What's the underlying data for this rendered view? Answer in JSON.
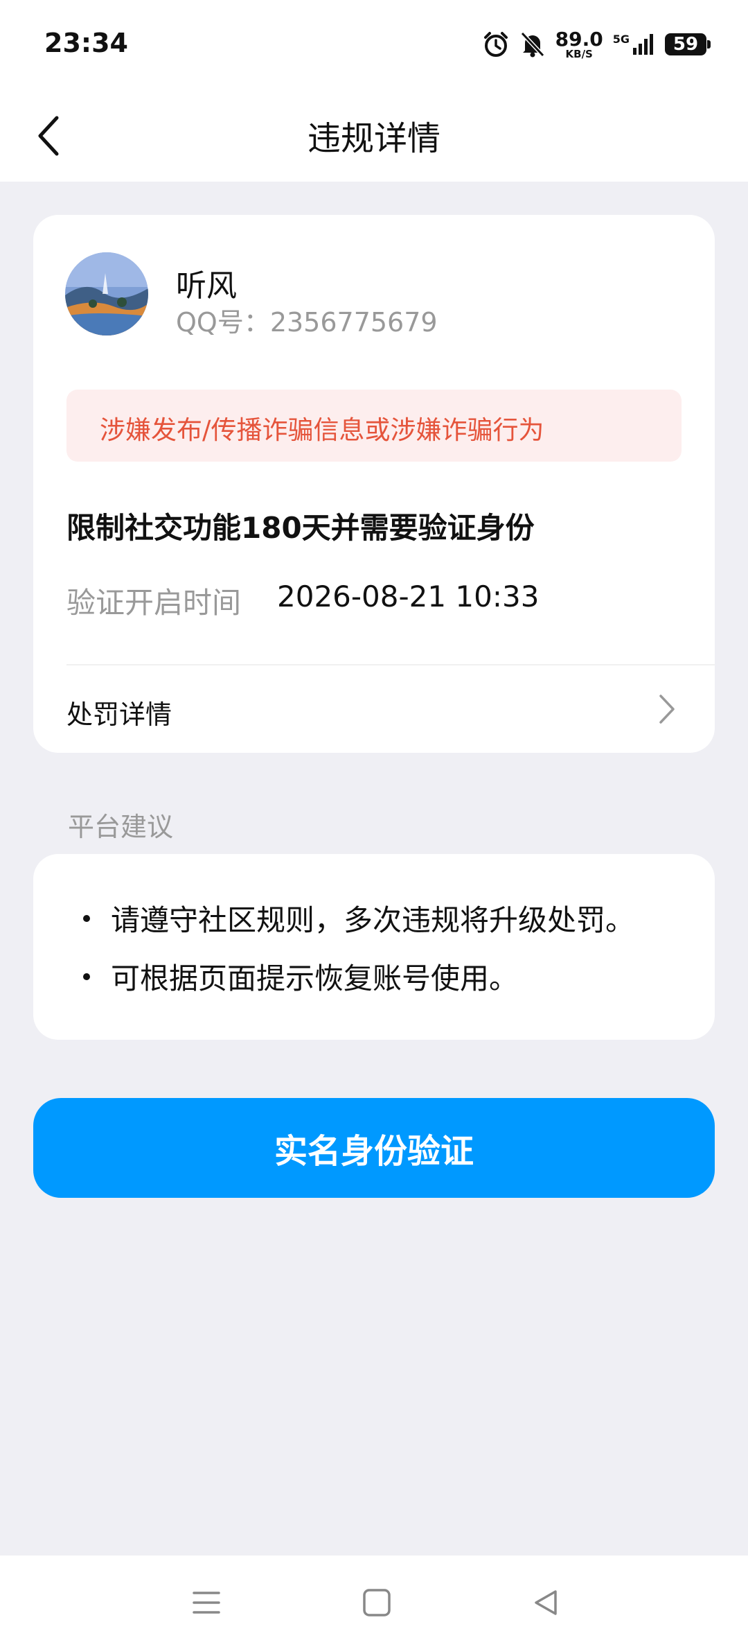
{
  "status_bar": {
    "time": "23:34",
    "net_speed_value": "89.0",
    "net_speed_unit": "KB/S",
    "network": "5G",
    "battery": "59"
  },
  "nav": {
    "title": "违规详情"
  },
  "user": {
    "name": "听风",
    "qq": "QQ号：2356775679"
  },
  "violation": {
    "reason": "涉嫌发布/传播诈骗信息或涉嫌诈骗行为",
    "restriction": "限制社交功能180天并需要验证身份",
    "verify_label": "验证开启时间",
    "verify_time": "2026-08-21 10:33",
    "detail_link": "处罚详情"
  },
  "advice": {
    "title": "平台建议",
    "items": [
      "请遵守社区规则，多次违规将升级处罚。",
      "可根据页面提示恢复账号使用。"
    ]
  },
  "cta": {
    "label": "实名身份验证"
  },
  "colors": {
    "accent": "#0099ff",
    "alert_bg": "#fdeeee",
    "alert_text": "#e5543b"
  }
}
